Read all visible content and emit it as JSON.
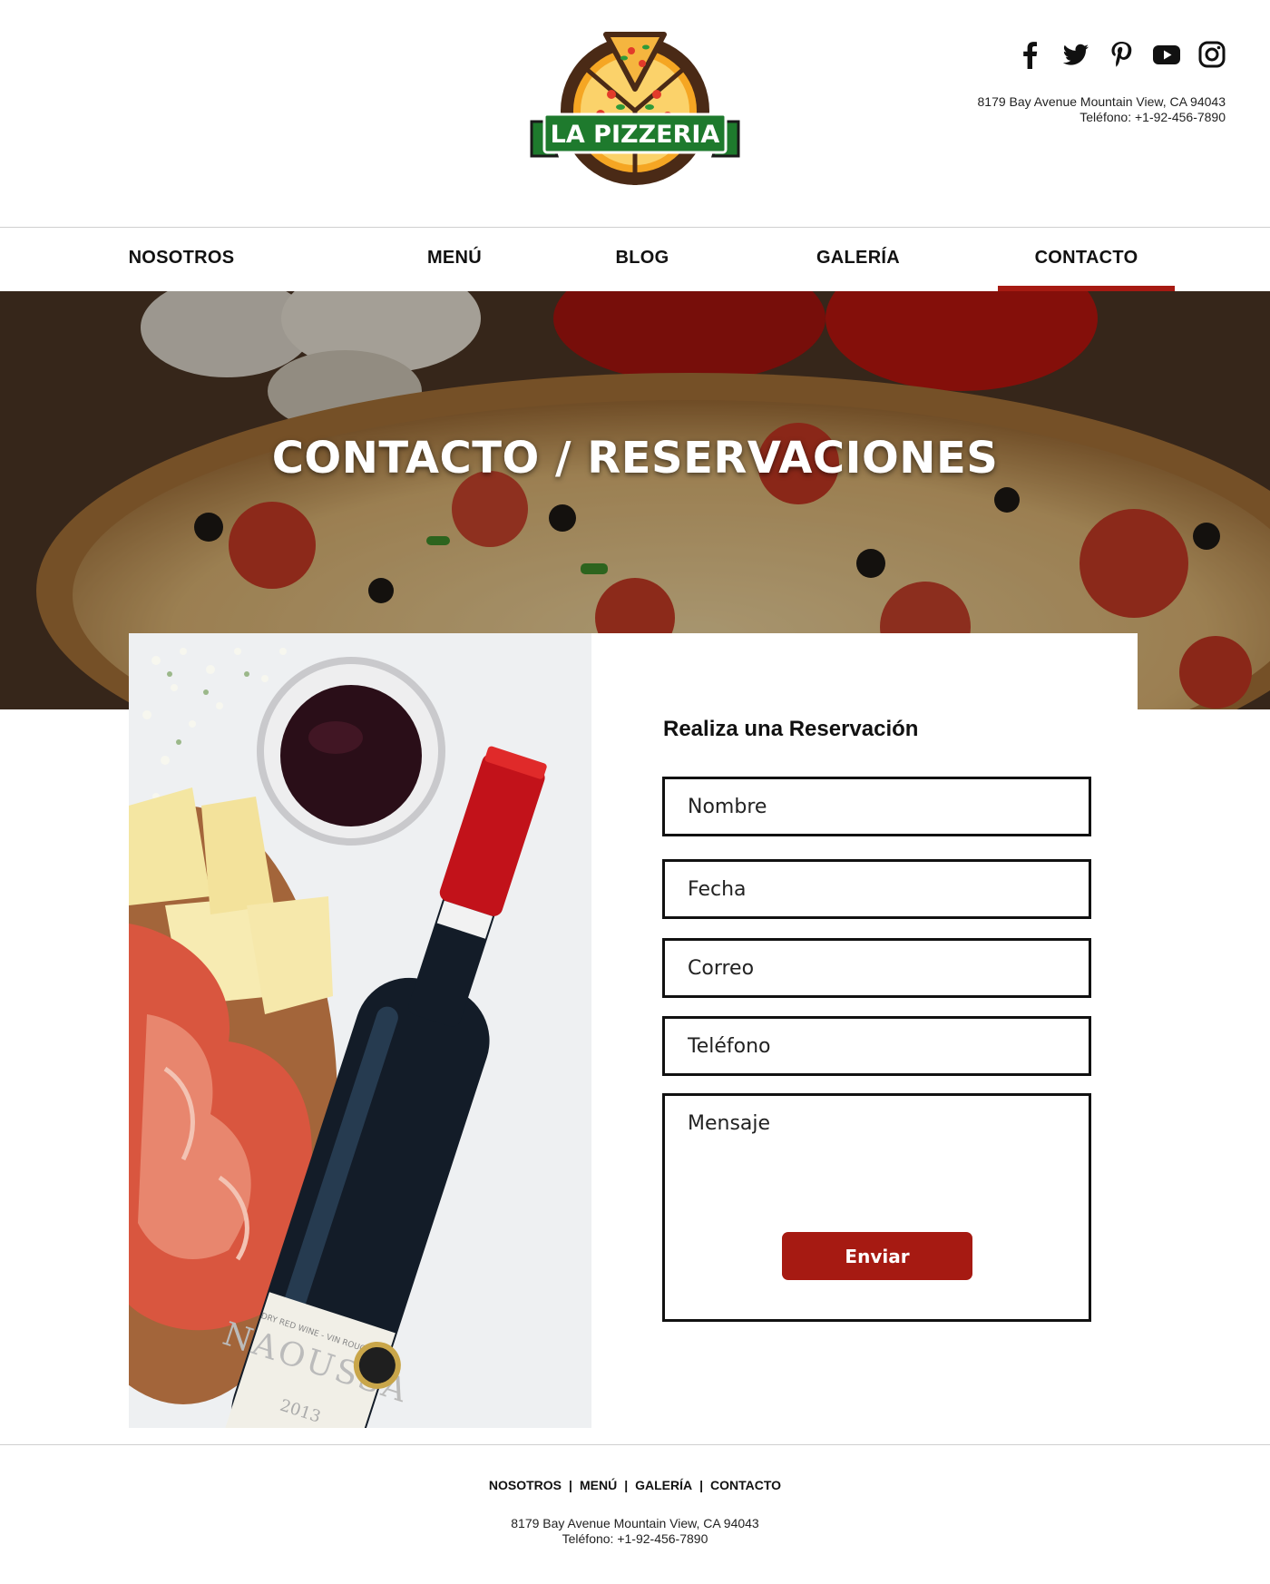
{
  "brand": {
    "name": "LA PIZZERIA"
  },
  "social": [
    "facebook-icon",
    "twitter-icon",
    "pinterest-icon",
    "youtube-icon",
    "instagram-icon"
  ],
  "contact_info": {
    "address": "8179 Bay Avenue  Mountain View, CA 94043",
    "phone": "Teléfono: +1-92-456-7890"
  },
  "nav": {
    "items": [
      {
        "label": "NOSOTROS"
      },
      {
        "label": "MENÚ"
      },
      {
        "label": "BLOG"
      },
      {
        "label": "GALERÍA"
      },
      {
        "label": "CONTACTO"
      }
    ],
    "active": "CONTACTO"
  },
  "hero": {
    "title": "CONTACTO / RESERVACIONES"
  },
  "form": {
    "title": "Realiza una Reservación",
    "fields": {
      "nombre": "Nombre",
      "fecha": "Fecha",
      "correo": "Correo",
      "telefono": "Teléfono",
      "mensaje": "Mensaje"
    },
    "submit": "Enviar"
  },
  "photo": {
    "label_text": "NAOUSSA",
    "label_small": "DRY RED WINE - VIN ROUGE SEC",
    "year": "2013"
  },
  "footer": {
    "nav": [
      "NOSOTROS",
      "MENÚ",
      "GALERÍA",
      "CONTACTO"
    ],
    "separator": "|",
    "address": "8179 Bay Avenue  Mountain View, CA 94043",
    "phone": "Teléfono: +1-92-456-7890"
  },
  "colors": {
    "accent": "#a61a12",
    "logo_green": "#1e7a2d",
    "logo_brown": "#4a2a16",
    "logo_orange": "#f0a73a"
  }
}
